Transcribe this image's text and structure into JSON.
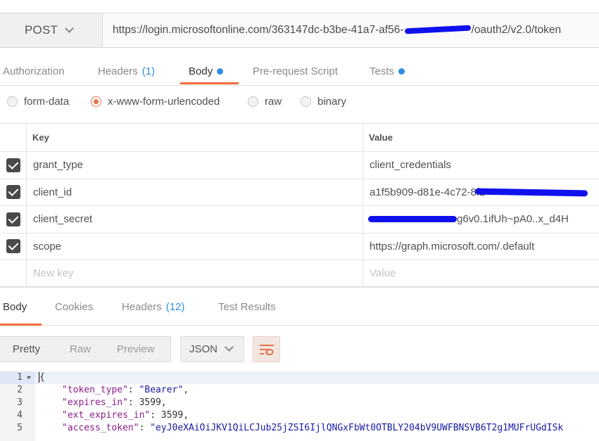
{
  "request": {
    "method": "POST",
    "url_prefix": "https://login.microsoftonline.com/363147dc-b3be-41a7-af56-",
    "url_suffix": "/oauth2/v2.0/token"
  },
  "request_tabs": [
    {
      "label": "Authorization"
    },
    {
      "label": "Headers",
      "count": "(1)"
    },
    {
      "label": "Body"
    },
    {
      "label": "Pre-request Script"
    },
    {
      "label": "Tests"
    }
  ],
  "body_types": [
    "form-data",
    "x-www-form-urlencoded",
    "raw",
    "binary"
  ],
  "selected_body_type": "x-www-form-urlencoded",
  "params": {
    "header_key": "Key",
    "header_value": "Value",
    "rows": [
      {
        "key": "grant_type",
        "value": "client_credentials"
      },
      {
        "key": "client_id",
        "value": "a1f5b909-d81e-4c72-8f2"
      },
      {
        "key": "client_secret",
        "value": "g6v0.1ifUh~pA0..x_d4H"
      },
      {
        "key": "scope",
        "value": "https://graph.microsoft.com/.default"
      }
    ],
    "new_key_placeholder": "New key",
    "new_value_placeholder": "Value"
  },
  "response_tabs": [
    {
      "label": "Body"
    },
    {
      "label": "Cookies"
    },
    {
      "label": "Headers",
      "count": "(12)"
    },
    {
      "label": "Test Results"
    }
  ],
  "format_modes": [
    "Pretty",
    "Raw",
    "Preview"
  ],
  "format_language": "JSON",
  "code_lines": [
    {
      "no": "1",
      "text": "{"
    },
    {
      "no": "2",
      "key": "\"token_type\"",
      "val": "\"Bearer\"",
      "tail": ","
    },
    {
      "no": "3",
      "key": "\"expires_in\"",
      "num": "3599",
      "tail": ","
    },
    {
      "no": "4",
      "key": "\"ext_expires_in\"",
      "num": "3599",
      "tail": ","
    },
    {
      "no": "5",
      "key": "\"access_token\"",
      "val": "\"eyJ0eXAiOiJKV1QiLCJub25jZSI6IjlQNGxFbWt0OTBLY204bV9UWFBNSVB6T2g1MUFrUGdISk"
    }
  ],
  "colors": {
    "accent": "#f26b3a",
    "link": "#2f8de4",
    "redaction": "#1010ee"
  }
}
